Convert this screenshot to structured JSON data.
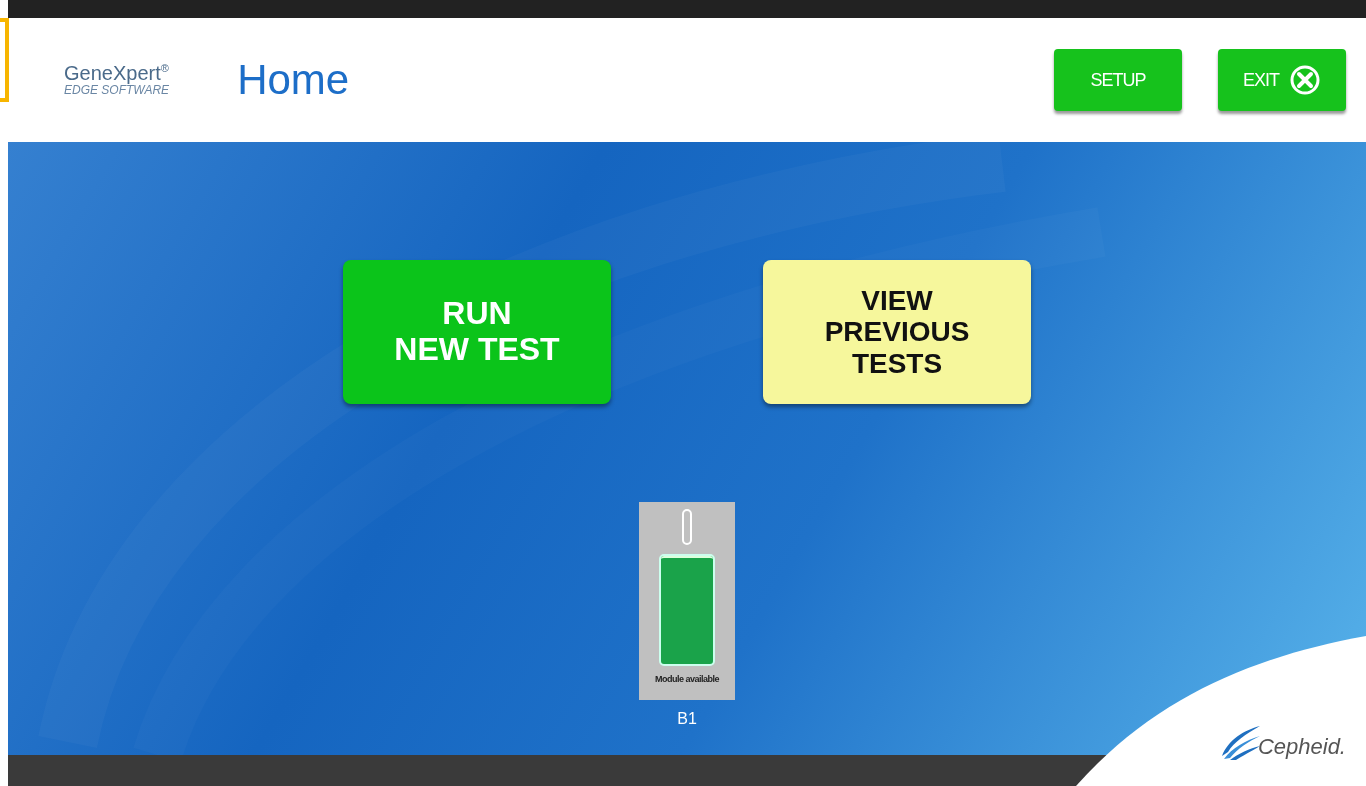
{
  "header": {
    "brand": "GeneXpert$^{®}$",
    "brand_subtitle": "EDGE SOFTWARE",
    "title": "Home",
    "buttons": [
      {
        "label": "SETUP",
        "kind": "plain"
      },
      {
        "label": "EXIT",
        "kind": "exit"
      }
    ]
  },
  "actions": [
    {
      "lines": [
        "RUN",
        "NEW TEST"
      ],
      "kind": "primary"
    },
    {
      "lines": [
        "VIEW",
        "PREVIOUS",
        "TESTS"
      ],
      "kind": "secondary"
    }
  ],
  "modules": [
    {
      "status": "Module available",
      "name": "B1",
      "color": "#1aa34a"
    }
  ],
  "footer": {
    "logo": "Cepheid."
  }
}
